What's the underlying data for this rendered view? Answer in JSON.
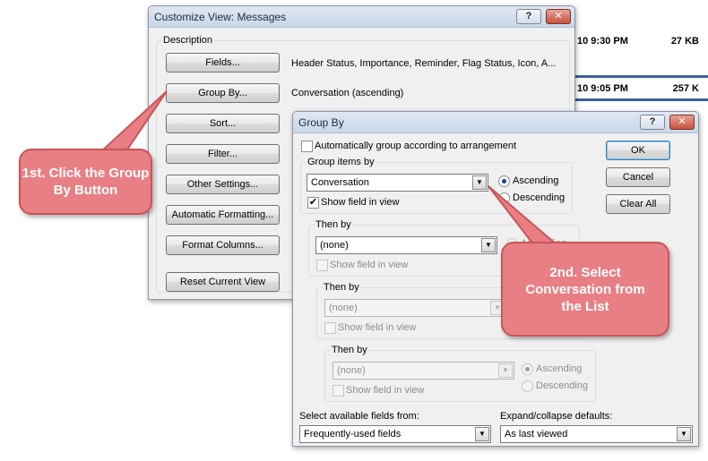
{
  "background_rows": [
    {
      "time": "10 9:30 PM",
      "size": "27 KB"
    },
    {
      "time": "10 9:05 PM",
      "size": "257 K"
    }
  ],
  "customize_view": {
    "title": "Customize View: Messages",
    "help_btn": "?",
    "close_btn": "✕",
    "description_label": "Description",
    "buttons": [
      {
        "label": "Fields...",
        "desc": "Header Status, Importance, Reminder, Flag Status, Icon, A..."
      },
      {
        "label": "Group By...",
        "desc": "Conversation (ascending)"
      },
      {
        "label": "Sort...",
        "desc": ""
      },
      {
        "label": "Filter...",
        "desc": ""
      },
      {
        "label": "Other Settings...",
        "desc": ""
      },
      {
        "label": "Automatic Formatting...",
        "desc": ""
      },
      {
        "label": "Format Columns...",
        "desc": ""
      }
    ],
    "reset_btn": "Reset Current View"
  },
  "group_by": {
    "title": "Group By",
    "help_btn": "?",
    "close_btn": "✕",
    "auto_group_label": "Automatically group according to arrangement",
    "group_items_label": "Group items by",
    "group1_value": "Conversation",
    "show_field_label": "Show field in view",
    "ascending_label": "Ascending",
    "descending_label": "Descending",
    "then_by_label": "Then by",
    "none_value": "(none)",
    "ok_btn": "OK",
    "cancel_btn": "Cancel",
    "clear_all_btn": "Clear All",
    "available_fields_label": "Select available fields from:",
    "available_fields_value": "Frequently-used fields",
    "expand_label": "Expand/collapse defaults:",
    "expand_value": "As last viewed",
    "arrow_glyph": "▼",
    "check_glyph": "✔"
  },
  "callouts": {
    "first": "1st. Click the Group By Button",
    "second": "2nd. Select Conversation from the List"
  },
  "colors": {
    "callout_fill": "#e87f84",
    "callout_border": "#c9555b",
    "title_bar": "#c9d7e8"
  }
}
